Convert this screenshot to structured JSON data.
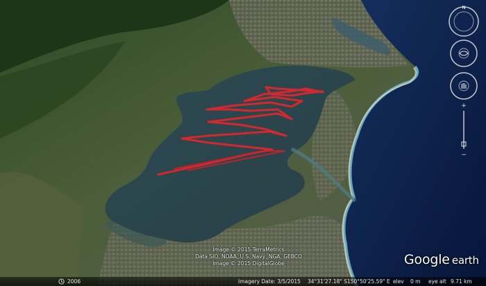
{
  "map": {
    "track_color": "#e3262c",
    "water_color": "#2a4650",
    "ocean_color": "#0a1d45"
  },
  "credits": {
    "line1": "Image © 2015 TerraMetrics",
    "line2": "Data SIO, NOAA, U.S. Navy, NGA, GEBCO",
    "line3": "Image © 2015 DigitalGlobe"
  },
  "logo": {
    "google": "Google",
    "earth": "earth"
  },
  "statusbar": {
    "year": "2006",
    "imagery_date": "Imagery Date: 3/5/2015",
    "lat": "34°31'27.18\" S",
    "lon": "150°50'25.59\" E",
    "elev_label": "elev",
    "elev_value": "0 m",
    "eye_alt_label": "eye alt",
    "eye_alt_value": "9.71 km"
  },
  "nav": {
    "north_label": "N"
  }
}
